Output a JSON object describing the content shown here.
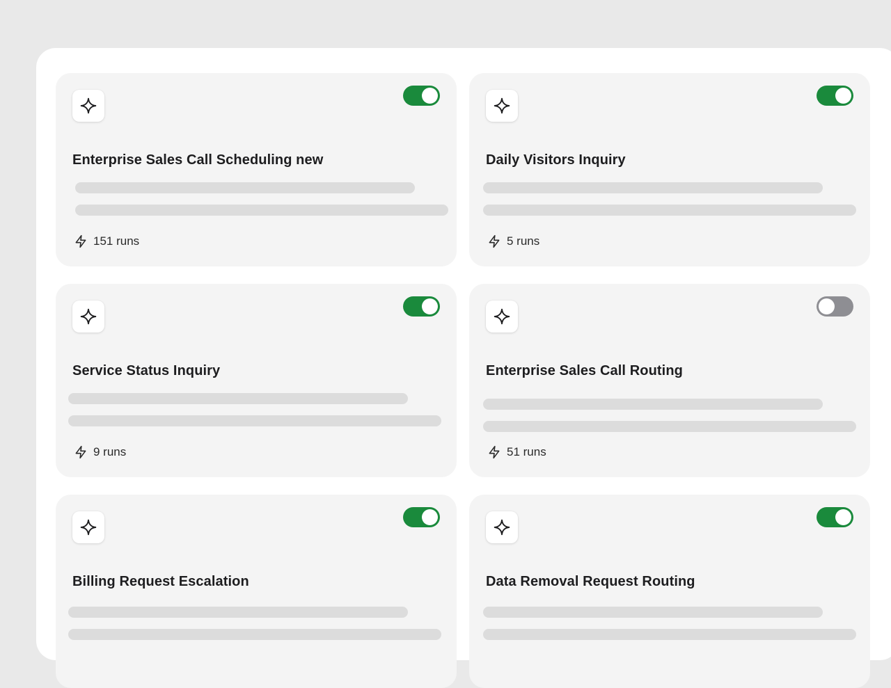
{
  "cards": [
    {
      "title": "Enterprise Sales Call Scheduling new",
      "runs": "151 runs",
      "enabled": true,
      "icon": "sparkle-icon",
      "run_icon": "lightning-icon"
    },
    {
      "title": "Daily Visitors Inquiry",
      "runs": "5 runs",
      "enabled": true,
      "icon": "sparkle-icon",
      "run_icon": "lightning-icon"
    },
    {
      "title": "Service Status Inquiry",
      "runs": "9 runs",
      "enabled": true,
      "icon": "sparkle-icon",
      "run_icon": "lightning-icon"
    },
    {
      "title": "Enterprise Sales Call Routing",
      "runs": "51 runs",
      "enabled": false,
      "icon": "sparkle-icon",
      "run_icon": "lightning-icon"
    },
    {
      "title": "Billing Request Escalation",
      "runs": "",
      "enabled": true,
      "icon": "sparkle-icon",
      "run_icon": "lightning-icon"
    },
    {
      "title": "Data Removal Request Routing",
      "runs": "",
      "enabled": true,
      "icon": "sparkle-icon",
      "run_icon": "lightning-icon"
    }
  ],
  "colors": {
    "toggle_on": "#1a8a3c",
    "toggle_off": "#8e8e93",
    "card_background": "#f4f4f4",
    "skeleton": "#dcdcdc"
  }
}
